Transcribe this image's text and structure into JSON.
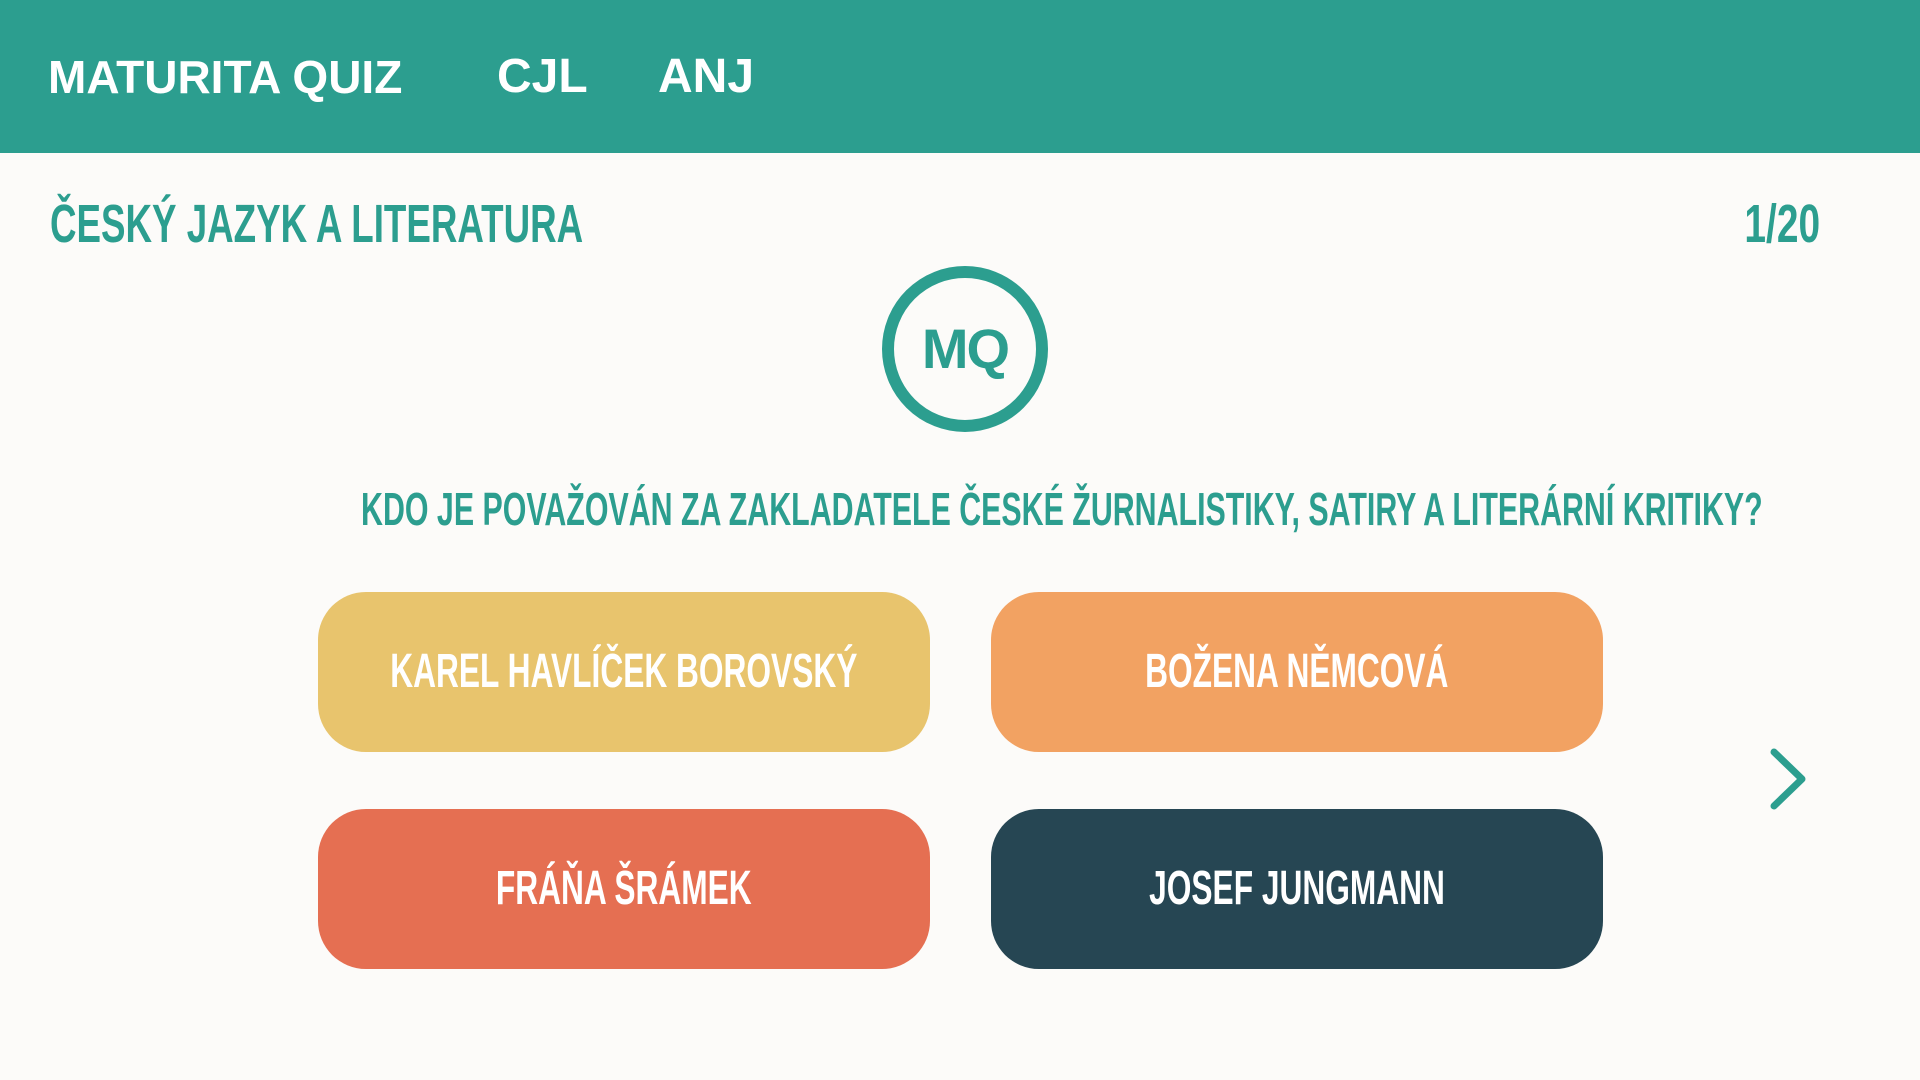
{
  "header": {
    "brand": "MATURITA QUIZ",
    "nav": [
      {
        "label": "CJL"
      },
      {
        "label": "ANJ"
      }
    ]
  },
  "quiz": {
    "subject": "ČESKÝ JAZYK A LITERATURA",
    "progress": "1/20",
    "logo_text": "MQ",
    "question": "KDO JE POVAŽOVÁN ZA ZAKLADATELE ČESKÉ ŽURNALISTIKY, SATIRY A LITERÁRNÍ KRITIKY?",
    "answers": [
      {
        "label": "KAREL HAVLÍČEK BOROVSKÝ",
        "color": "#e8c46d"
      },
      {
        "label": "BOŽENA NĚMCOVÁ",
        "color": "#f2a262"
      },
      {
        "label": "FRÁŇA ŠRÁMEK",
        "color": "#e56f52"
      },
      {
        "label": "JOSEF JUNGMANN",
        "color": "#264653"
      }
    ],
    "next_icon": "chevron-right-icon"
  },
  "colors": {
    "accent": "#2c9e8f",
    "background": "#fcfbf9",
    "text_on_accent": "#ffffff"
  }
}
